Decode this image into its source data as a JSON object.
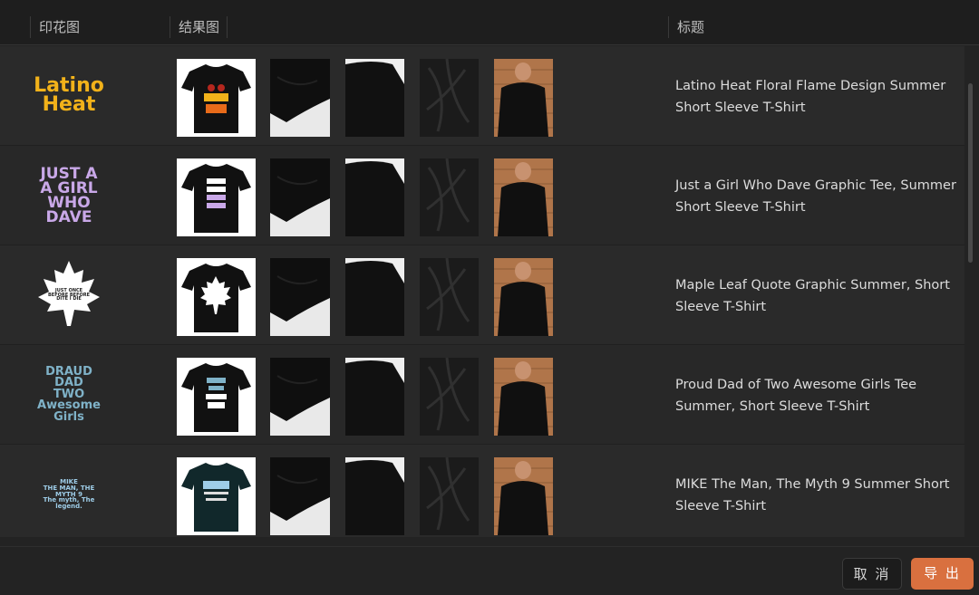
{
  "header": {
    "col_print": "印花图",
    "col_result": "结果图",
    "col_title": "标题"
  },
  "rows": [
    {
      "print_text": "Latino\nHeat",
      "print_color": "#f2b21a",
      "title": "Latino Heat Floral Flame Design Summer Short Sleeve T-Shirt"
    },
    {
      "print_text": "JUST A\nA GIRL\nWHO\nDAVE",
      "print_color": "#c9a8e8",
      "title": "Just a Girl Who Dave Graphic Tee, Summer Short Sleeve T-Shirt"
    },
    {
      "print_text": "JUST ONCE\nBEFORE BEFORE\nDITE I DIE",
      "print_color": "#ffffff",
      "title": "Maple Leaf Quote Graphic Summer, Short Sleeve T-Shirt"
    },
    {
      "print_text": "DRAUD\nDAD\nTWO\nAwesome\nGirls",
      "print_color": "#7fb2c8",
      "title": "Proud Dad of Two Awesome Girls Tee Summer, Short Sleeve T-Shirt"
    },
    {
      "print_text": "MIKE\nTHE MAN, THE MYTH 9\nThe myth, The legend.",
      "print_color": "#9ecde8",
      "title": "MIKE The Man, The Myth 9 Summer Short Sleeve T-Shirt"
    }
  ],
  "footer": {
    "cancel_label": "取 消",
    "export_label": "导 出"
  },
  "colors": {
    "accent": "#d9703f",
    "background": "#232323"
  }
}
